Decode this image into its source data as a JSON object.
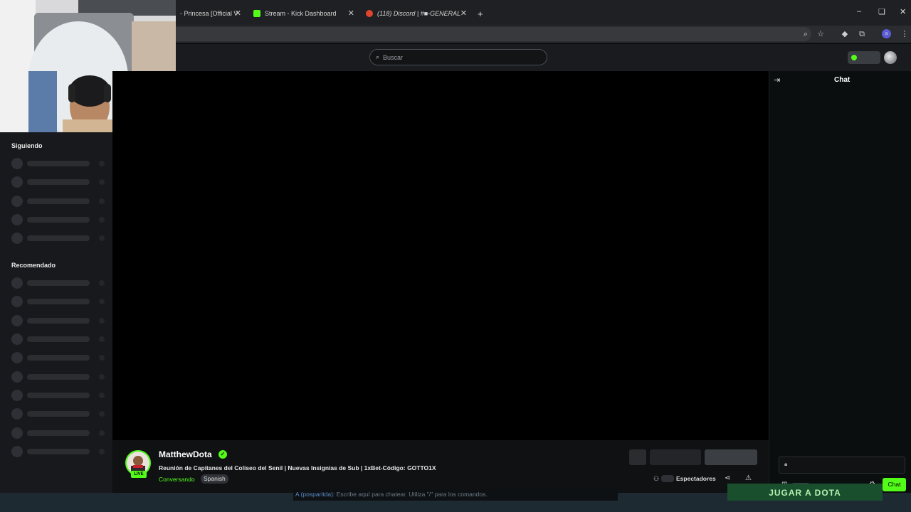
{
  "browser": {
    "tabs": [
      {
        "label": "- Princesa [Official V",
        "favicon_color": "#c23b3b"
      },
      {
        "label": "Stream - Kick Dashboard",
        "favicon_color": "#53fc18"
      },
      {
        "label": "(118) Discord | #■-GENERAL",
        "favicon_color": "#e0452f"
      }
    ],
    "new_tab": "+",
    "window_controls": {
      "minimize": "–",
      "restore": "❏",
      "close": "✕"
    }
  },
  "header": {
    "search_placeholder": "Buscar"
  },
  "sidebar": {
    "following_title": "Siguiendo",
    "recommended_title": "Recomendado"
  },
  "stream": {
    "streamer_name": "MatthewDota",
    "live_badge": "LIVE",
    "title": "Reunión de Capitanes del Coliseo del Senil | Nuevas Insignias de Sub | 1xBet-Código: GOTTO1X",
    "category": "Conversando",
    "language": "Spanish",
    "viewers_label": "Espectadores"
  },
  "chat": {
    "title": "Chat",
    "send_label": "Chat"
  },
  "overlay": {
    "chat_prefix": "A (posparitda):",
    "chat_hint": "Escribe aquí para chatear. Utiliza \"/\" para los comandos.",
    "banner_text": "JUGAR A DOTA"
  },
  "colors": {
    "accent": "#53fc18",
    "background": "#0b0e0f",
    "sidebar": "#18191d"
  },
  "icons": [
    "search-icon",
    "zoom-icon",
    "star-icon",
    "extension-icon",
    "profile-icon",
    "verified-icon",
    "share-icon",
    "report-icon",
    "lock-icon",
    "gift-icon",
    "settings-icon",
    "collapse-chat-icon",
    "viewers-icon"
  ]
}
